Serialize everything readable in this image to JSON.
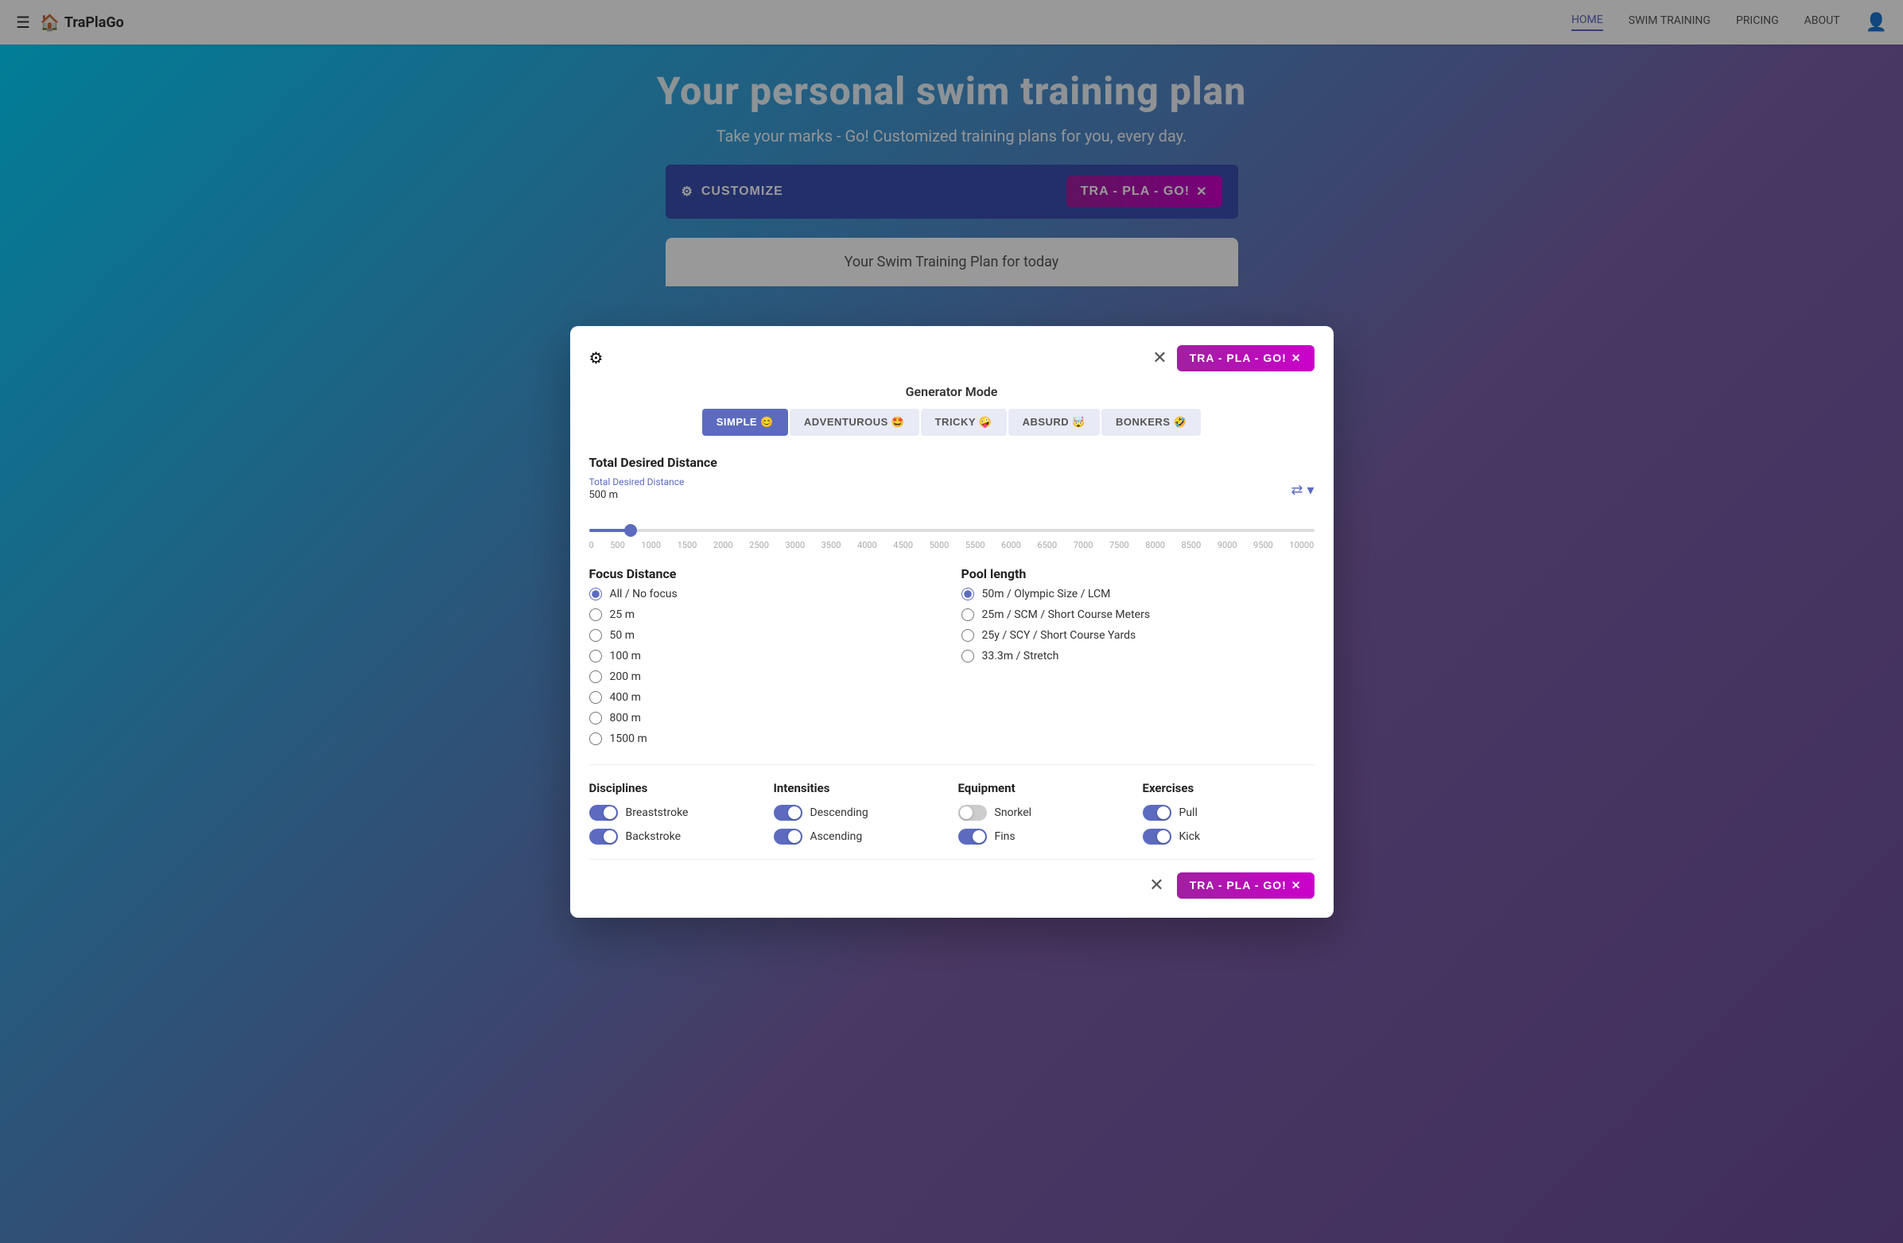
{
  "nav": {
    "brand": "TraPlaGo",
    "menu_icon": "☰",
    "logo_icon": "🏠",
    "links": [
      "HOME",
      "SWIM TRAINING",
      "PRICING",
      "ABOUT"
    ],
    "active_link": "HOME",
    "user_icon": "👤"
  },
  "hero": {
    "title": "Your personal swim training plan",
    "subtitle": "Take your marks - Go! Customized training plans for you, every day."
  },
  "customize_bar": {
    "gear_icon": "⚙",
    "label": "CUSTOMIZE",
    "tra_pla_go_label": "TRA - PLA - GO!",
    "shuffle_icon": "✕"
  },
  "plan_card": {
    "title": "Your Swim Training Plan for today"
  },
  "modal": {
    "gear_icon": "⚙",
    "close_icon": "✕",
    "tra_pla_go_label": "TRA - PLA - GO!",
    "shuffle_icon": "✕",
    "generator_mode_label": "Generator Mode",
    "mode_tabs": [
      {
        "label": "SIMPLE 😊",
        "active": true
      },
      {
        "label": "ADVENTUROUS 🤩",
        "active": false
      },
      {
        "label": "TRICKY 🤪",
        "active": false
      },
      {
        "label": "ABSURD 🤯",
        "active": false
      },
      {
        "label": "BONKERS 🤣",
        "active": false
      }
    ],
    "distance_section": {
      "title": "Total Desired Distance",
      "field_label": "Total Desired Distance",
      "value": "500 m",
      "slider_min": 0,
      "slider_max": 10000,
      "slider_current": 500,
      "slider_labels": [
        "0",
        "500",
        "1000",
        "1500",
        "2000",
        "2500",
        "3000",
        "3500",
        "4000",
        "4500",
        "5000",
        "5500",
        "6000",
        "6500",
        "7000",
        "7500",
        "8000",
        "8500",
        "9000",
        "9500",
        "10000"
      ],
      "reset_icon": "⇄"
    },
    "focus_distance": {
      "title": "Focus Distance",
      "options": [
        {
          "label": "All / No focus",
          "value": "all",
          "checked": true
        },
        {
          "label": "25 m",
          "value": "25m",
          "checked": false
        },
        {
          "label": "50 m",
          "value": "50m",
          "checked": false
        },
        {
          "label": "100 m",
          "value": "100m",
          "checked": false
        },
        {
          "label": "200 m",
          "value": "200m",
          "checked": false
        },
        {
          "label": "400 m",
          "value": "400m",
          "checked": false
        },
        {
          "label": "800 m",
          "value": "800m",
          "checked": false
        },
        {
          "label": "1500 m",
          "value": "1500m",
          "checked": false
        }
      ]
    },
    "pool_length": {
      "title": "Pool length",
      "options": [
        {
          "label": "50m / Olympic Size / LCM",
          "value": "50m",
          "checked": true
        },
        {
          "label": "25m / SCM / Short Course Meters",
          "value": "25m",
          "checked": false
        },
        {
          "label": "25y / SCY / Short Course Yards",
          "value": "25y",
          "checked": false
        },
        {
          "label": "33.3m / Stretch",
          "value": "33m",
          "checked": false
        }
      ]
    },
    "disciplines": {
      "title": "Disciplines",
      "items": [
        {
          "label": "Breaststroke",
          "on": true
        },
        {
          "label": "Backstroke",
          "on": true
        }
      ]
    },
    "intensities": {
      "title": "Intensities",
      "items": [
        {
          "label": "Descending",
          "on": true
        },
        {
          "label": "Ascending",
          "on": true
        }
      ]
    },
    "equipment": {
      "title": "Equipment",
      "items": [
        {
          "label": "Snorkel",
          "on": false
        },
        {
          "label": "Fins",
          "on": true
        }
      ]
    },
    "exercises": {
      "title": "Exercises",
      "items": [
        {
          "label": "Pull",
          "on": true
        },
        {
          "label": "Kick",
          "on": true
        }
      ]
    },
    "footer_close_icon": "✕",
    "footer_tra_pla_go": "TRA - PLA - GO!",
    "footer_shuffle_icon": "✕"
  }
}
